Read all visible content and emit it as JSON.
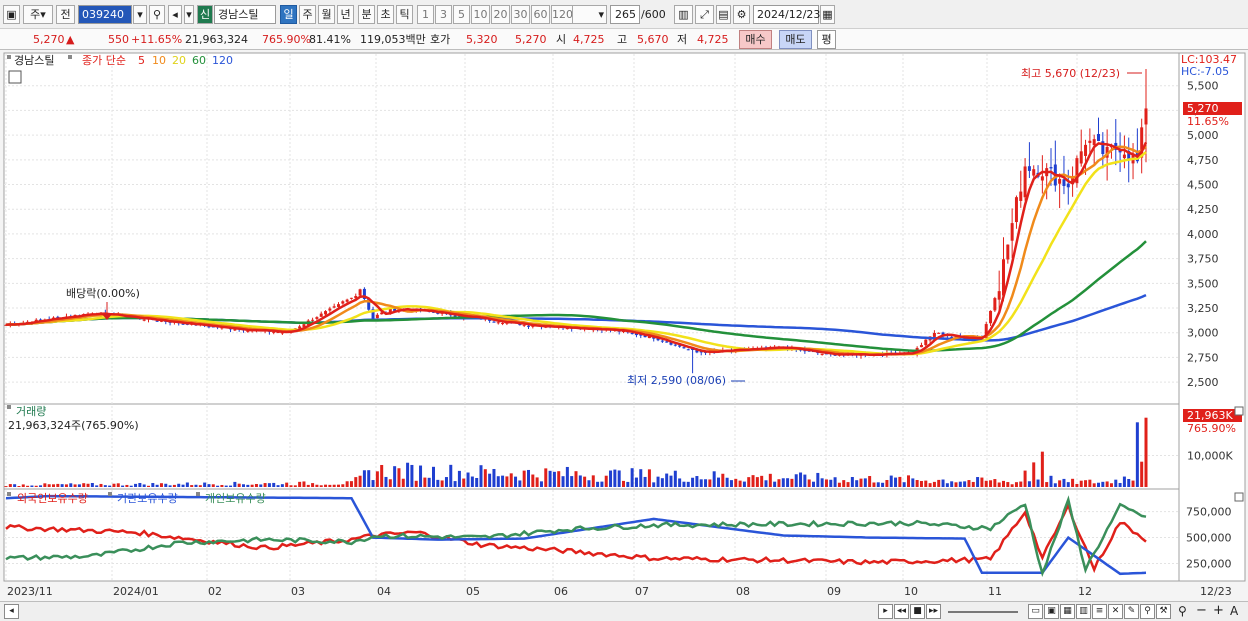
{
  "toolbar": {
    "market_selector": "주",
    "prev_label": "전",
    "stock_code": "039240",
    "new_badge": "신",
    "stock_name": "경남스틸",
    "periods": [
      "일",
      "주",
      "월",
      "년",
      "분",
      "초",
      "틱"
    ],
    "active_period": "일",
    "intervals": [
      "1",
      "3",
      "5",
      "10",
      "20",
      "30",
      "60",
      "120"
    ],
    "count_value": "265",
    "count_total": "/600",
    "date": "2024/12/23"
  },
  "quote": {
    "price": "5,270",
    "arrow": "▲",
    "change": "550",
    "change_pct": "+11.65%",
    "volume": "21,963,324",
    "volume_pct": "765.90%",
    "ratio": "81.41%",
    "amount": "119,053백만",
    "hoga_label": "호가",
    "hoga_ask": "5,320",
    "hoga_bid": "5,270",
    "open_label": "시",
    "open": "4,725",
    "high_label": "고",
    "high": "5,670",
    "low_label": "저",
    "low": "4,725",
    "buy_label": "매수",
    "sell_label": "매도",
    "eval_label": "평"
  },
  "legend": {
    "stock": "경남스틸",
    "series_label": "종가 단순",
    "ma5": "5",
    "ma10": "10",
    "ma20": "20",
    "ma60": "60",
    "ma120": "120"
  },
  "annotations": {
    "lc": "LC:103.47",
    "hc": "HC:-7.05",
    "current_price": "5,270",
    "current_pct": "11.65%",
    "high_note": "최고 5,670 (12/23)",
    "low_note": "최저 2,590 (08/06)",
    "dividend_note": "배당락(0.00%)",
    "volume_title": "거래량",
    "volume_info": "21,963,324주(765.90%)",
    "volume_current": "21,963K",
    "volume_pct": "765.90%",
    "holdings_legend": [
      "외국인보유수량",
      "기관보유수량",
      "개인보유수량"
    ]
  },
  "colors": {
    "up": "#e0201a",
    "down": "#1f3fd0",
    "ma5": "#e0201a",
    "ma10": "#f08a1a",
    "ma20": "#f2e21a",
    "ma60": "#23903a",
    "ma120": "#2a55d8",
    "foreign": "#e0201a",
    "institution": "#2a55d8",
    "individual": "#3a8f5a"
  },
  "chart_data": {
    "type": "candlestick",
    "price_axis": {
      "ticks": [
        "5,500",
        "5,250",
        "5,000",
        "4,750",
        "4,500",
        "4,250",
        "4,000",
        "3,750",
        "3,500",
        "3,250",
        "3,000",
        "2,750",
        "2,500"
      ],
      "ylim": [
        2400,
        5720
      ]
    },
    "volume_axis": {
      "ticks": [
        "10,000K"
      ]
    },
    "holdings_axis": {
      "ticks": [
        "750,000",
        "500,000",
        "250,000"
      ]
    },
    "x_labels": [
      "2023/11",
      "2024/01",
      "02",
      "03",
      "04",
      "05",
      "06",
      "07",
      "08",
      "09",
      "10",
      "11",
      "12",
      "12/23"
    ],
    "price_anchors": {
      "index": [
        0,
        20,
        50,
        65,
        80,
        82,
        85,
        90,
        100,
        120,
        140,
        150,
        160,
        180,
        190,
        200,
        210,
        215,
        220,
        226,
        230,
        236,
        240,
        246,
        250,
        255,
        258,
        262,
        264
      ],
      "close": [
        3080,
        3200,
        3050,
        3000,
        3350,
        3450,
        3150,
        3250,
        3200,
        3080,
        3030,
        2950,
        2800,
        2850,
        2780,
        2780,
        2800,
        3000,
        2950,
        2950,
        3500,
        4700,
        4650,
        4500,
        4950,
        4800,
        4900,
        4720,
        5270
      ]
    },
    "volume_anchors": {
      "index": [
        0,
        80,
        85,
        230,
        232,
        238,
        240,
        241,
        245,
        255,
        262,
        264
      ],
      "value": [
        900,
        1600,
        6800,
        2500,
        2100,
        2400,
        4000,
        3600,
        2200,
        2100,
        5000,
        21963
      ]
    },
    "holdings": [
      {
        "name": "외국인보유수량",
        "index": [
          0,
          30,
          60,
          80,
          85,
          95,
          110,
          130,
          150,
          180,
          200,
          228,
          236,
          240,
          246,
          252,
          258,
          264
        ],
        "value": [
          600000,
          550000,
          400000,
          480000,
          520000,
          550000,
          430000,
          370000,
          300000,
          280000,
          260000,
          290000,
          750000,
          300000,
          800000,
          200000,
          650000,
          480000
        ]
      },
      {
        "name": "기관보유수량",
        "index": [
          0,
          10,
          80,
          85,
          100,
          120,
          150,
          180,
          200,
          222,
          226,
          240,
          246,
          258,
          264
        ],
        "value": [
          880000,
          900000,
          880000,
          500000,
          480000,
          490000,
          680000,
          520000,
          500000,
          490000,
          160000,
          160000,
          500000,
          150000,
          160000
        ]
      },
      {
        "name": "개인보유수량",
        "index": [
          0,
          20,
          40,
          60,
          80,
          86,
          110,
          130,
          150,
          180,
          210,
          228,
          236,
          240,
          246,
          250,
          258,
          264
        ],
        "value": [
          300000,
          320000,
          450000,
          480000,
          460000,
          520000,
          500000,
          580000,
          620000,
          630000,
          640000,
          590000,
          830000,
          150000,
          850000,
          200000,
          800000,
          700000
        ]
      }
    ]
  }
}
